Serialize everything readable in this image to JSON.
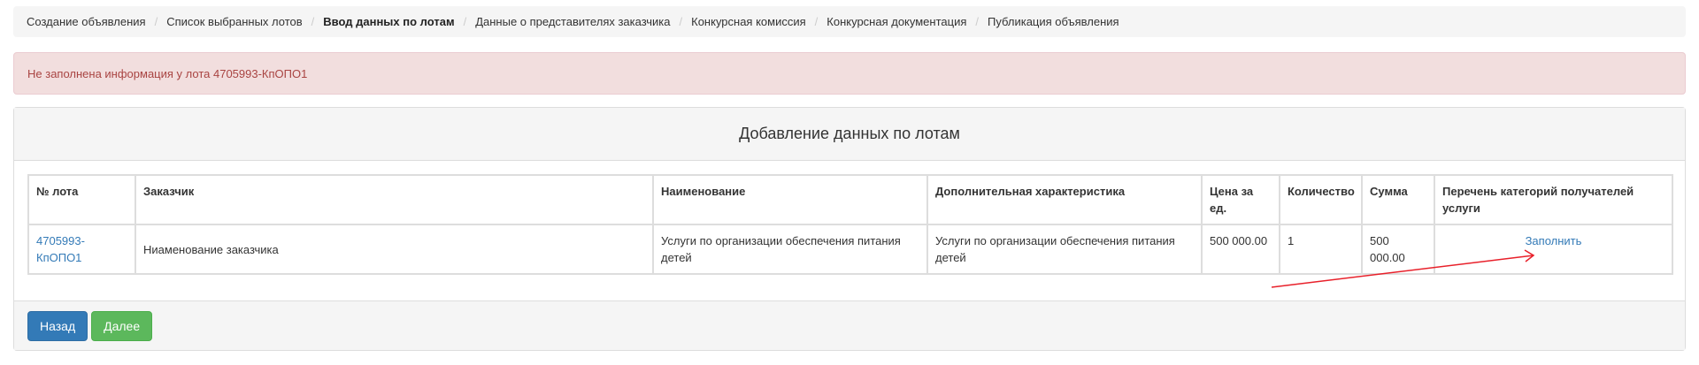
{
  "breadcrumb": {
    "items": [
      {
        "label": "Создание объявления",
        "active": false
      },
      {
        "label": "Список выбранных лотов",
        "active": false
      },
      {
        "label": "Ввод данных по лотам",
        "active": true
      },
      {
        "label": "Данные о представителях заказчика",
        "active": false
      },
      {
        "label": "Конкурсная комиссия",
        "active": false
      },
      {
        "label": "Конкурсная документация",
        "active": false
      },
      {
        "label": "Публикация объявления",
        "active": false
      }
    ]
  },
  "alert": {
    "text": "Не заполнена информация у лота 4705993-КпОПО1"
  },
  "panel": {
    "title": "Добавление данных по лотам"
  },
  "table": {
    "headers": {
      "lot": "№ лота",
      "customer": "Заказчик",
      "name": "Наименование",
      "extra": "Дополнительная характеристика",
      "price": "Цена за ед.",
      "qty": "Количество",
      "sum": "Сумма",
      "categories": "Перечень категорий получателей услуги"
    },
    "rows": [
      {
        "lot": "4705993-КпОПО1",
        "customer": "Ниаменование заказчика",
        "name": "Услуги по организации обеспечения питания детей",
        "extra": "Услуги по организации обеспечения питания детей",
        "price": "500 000.00",
        "qty": "1",
        "sum": "500 000.00",
        "action": "Заполнить"
      }
    ]
  },
  "footer": {
    "back_label": "Назад",
    "next_label": "Далее"
  },
  "colors": {
    "annotation_arrow": "#e8202a"
  }
}
